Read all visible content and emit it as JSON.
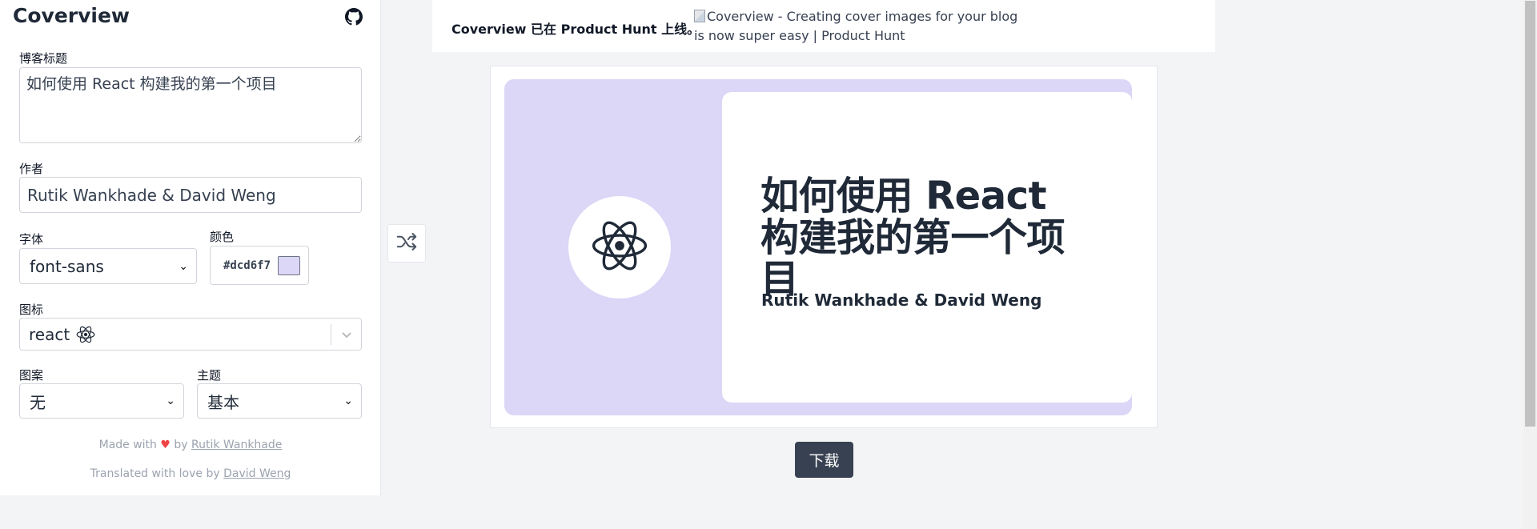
{
  "sidebar": {
    "title": "Coverview",
    "icons": {
      "github": "github-icon"
    },
    "blog_title": {
      "label": "博客标题",
      "value": "如何使用 React 构建我的第一个项目"
    },
    "author": {
      "label": "作者",
      "value": "Rutik Wankhade & David Weng"
    },
    "font": {
      "label": "字体",
      "value": "font-sans"
    },
    "color": {
      "label": "颜色",
      "value": "#dcd6f7"
    },
    "icon": {
      "label": "图标",
      "value": "react"
    },
    "pattern": {
      "label": "图案",
      "value": "无"
    },
    "theme": {
      "label": "主题",
      "value": "基本"
    },
    "footer": {
      "made_with": "Made with",
      "by": "by",
      "author_link": "Rutik Wankhade",
      "translated": "Translated with love by",
      "translator_link": "David Weng"
    }
  },
  "banner": {
    "text": "Coverview 已在 Product Hunt 上线。",
    "image_alt": "Coverview - Creating cover images for your blog is now super easy | Product Hunt"
  },
  "preview": {
    "title": "如何使用 React 构建我的第一个项目",
    "author": "Rutik Wankhade & David Weng",
    "background_color": "#dcd6f7",
    "icon": "react-icon"
  },
  "actions": {
    "shuffle_icon": "shuffle-icon",
    "download_label": "下载"
  }
}
